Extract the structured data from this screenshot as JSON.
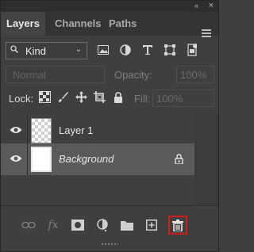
{
  "panel": {
    "tabs": [
      {
        "label": "Layers",
        "active": true
      },
      {
        "label": "Channels",
        "active": false
      },
      {
        "label": "Paths",
        "active": false
      }
    ],
    "collapse_glyph": "«",
    "close_glyph": "×"
  },
  "filter": {
    "kind_label": "Kind",
    "filter_icons": [
      "image-filter-icon",
      "adjustment-filter-icon",
      "type-filter-icon",
      "shape-filter-icon",
      "smart-object-filter-icon"
    ]
  },
  "blend": {
    "mode": "Normal",
    "opacity_label": "Opacity:",
    "opacity_value": "100%"
  },
  "lock": {
    "label": "Lock:",
    "fill_label": "Fill:",
    "fill_value": "100%"
  },
  "layers": [
    {
      "name": "Layer 1",
      "thumbnail": "transparent",
      "visible": true,
      "selected": false,
      "locked": false,
      "italic": false
    },
    {
      "name": "Background",
      "thumbnail": "white",
      "visible": true,
      "selected": true,
      "locked": true,
      "italic": true
    }
  ],
  "bottom_bar": {
    "icons": [
      "link-layers-icon",
      "fx-icon",
      "add-mask-icon",
      "adjustment-layer-icon",
      "new-group-icon",
      "new-layer-icon",
      "delete-layer-icon"
    ],
    "highlight_color": "#d21d1d"
  }
}
